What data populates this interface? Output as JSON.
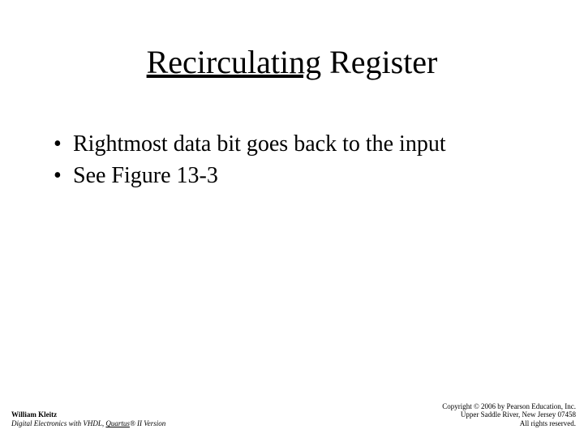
{
  "title": {
    "underlined": "Recirculating",
    "plain": " Register"
  },
  "bullets": [
    "Rightmost data bit goes back to the input",
    "See Figure 13-3"
  ],
  "footer_left": {
    "author": "William Kleitz",
    "book_prefix": "Digital Electronics with VHDL, ",
    "book_underlined": "Quartus",
    "book_suffix": "® II Version"
  },
  "footer_right": {
    "line1": "Copyright © 2006 by Pearson Education, Inc.",
    "line2": "Upper Saddle River, New Jersey 07458",
    "line3": "All rights reserved."
  }
}
